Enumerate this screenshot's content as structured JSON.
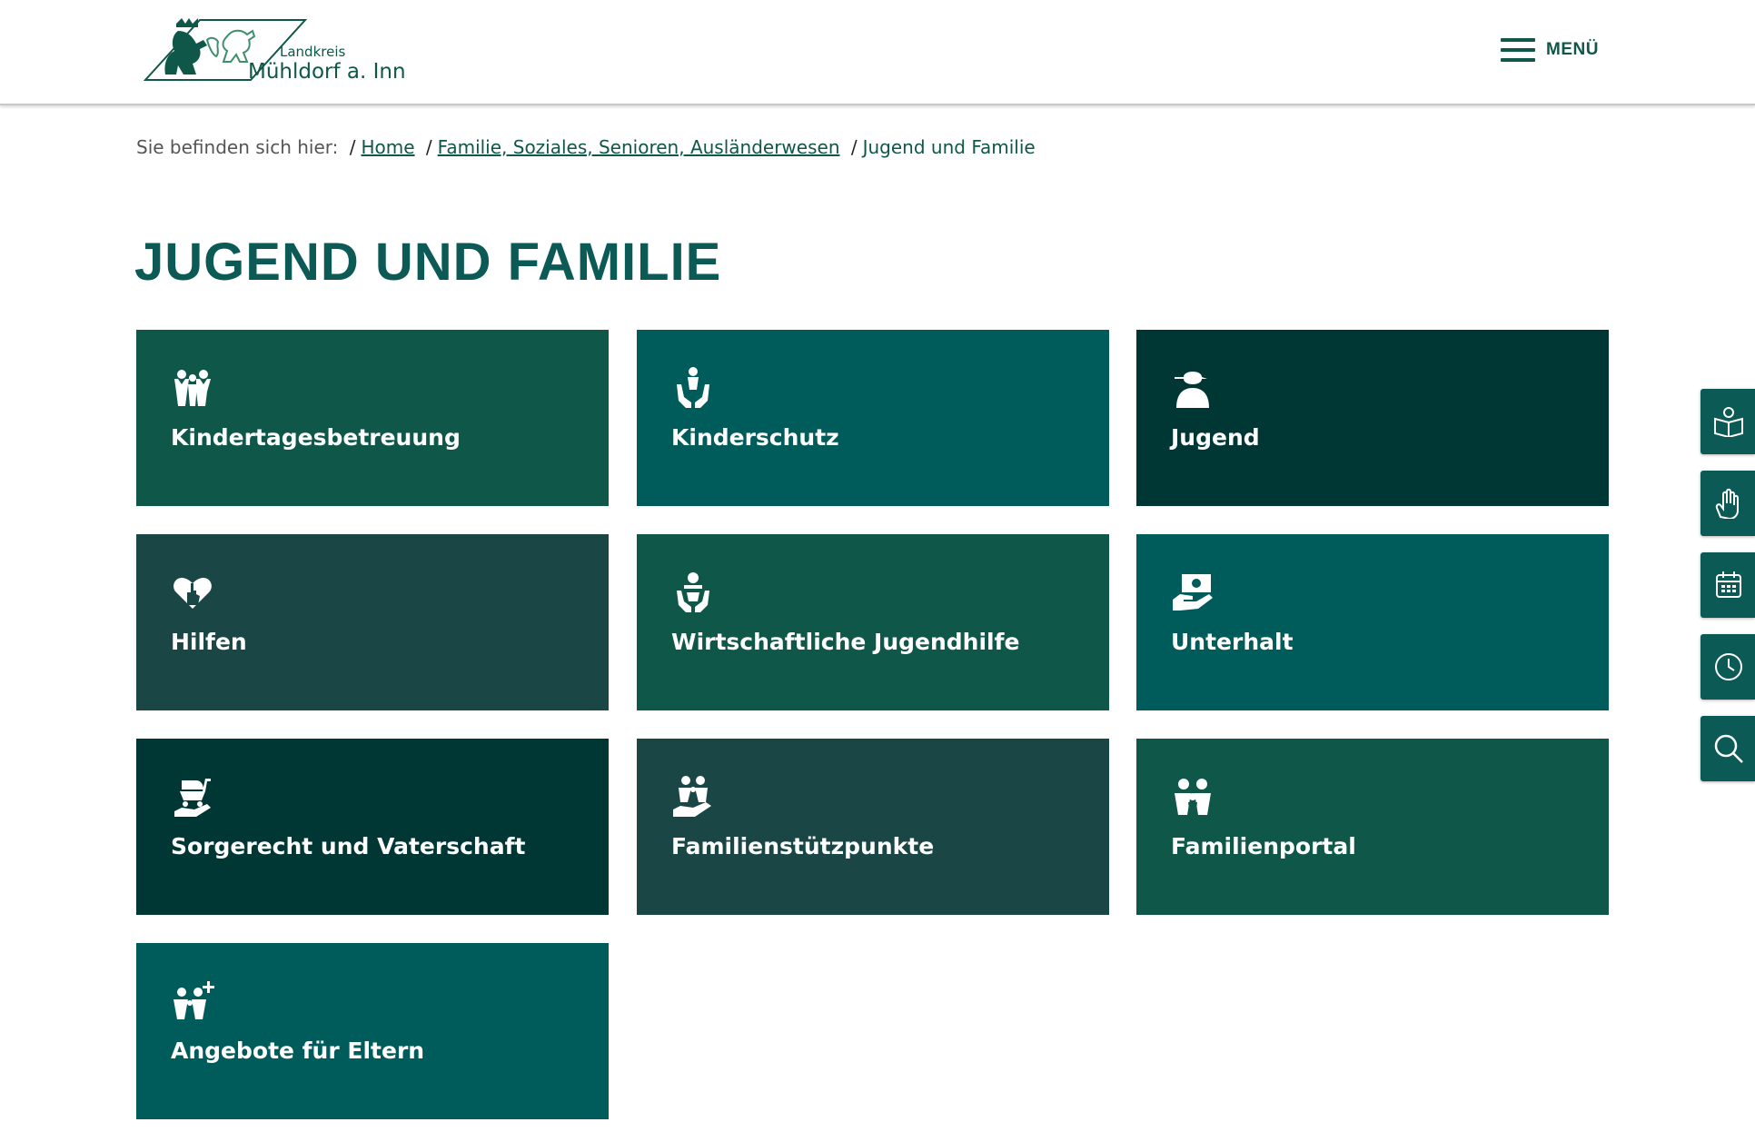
{
  "header": {
    "logo_small": "Landkreis",
    "logo_big": "Mühldorf a. Inn",
    "menu_label": "MENÜ"
  },
  "breadcrumb": {
    "prefix": "Sie befinden sich hier:",
    "separator": "/",
    "items": [
      {
        "label": "Home"
      },
      {
        "label": "Familie, Soziales, Senioren, Ausländerwesen"
      }
    ],
    "current": "Jugend und Familie"
  },
  "page": {
    "title": "JUGEND UND FAMILIE"
  },
  "tiles": [
    {
      "label": "Kindertagesbetreuung",
      "icon": "children-group-icon",
      "color": "#0e5749"
    },
    {
      "label": "Kinderschutz",
      "icon": "child-protection-hands-icon",
      "color": "#005c5a"
    },
    {
      "label": "Jugend",
      "icon": "youth-cap-icon",
      "color": "#003735"
    },
    {
      "label": "Hilfen",
      "icon": "heart-hand-icon",
      "color": "#1b4646"
    },
    {
      "label": "Wirtschaftliche Jugendhilfe",
      "icon": "person-hands-icon",
      "color": "#0e5749"
    },
    {
      "label": "Unterhalt",
      "icon": "money-hand-icon",
      "color": "#005c5a"
    },
    {
      "label": "Sorgerecht und Vaterschaft",
      "icon": "stroller-hand-icon",
      "color": "#003735"
    },
    {
      "label": "Familienstützpunkte",
      "icon": "family-hand-icon",
      "color": "#1b4646"
    },
    {
      "label": "Familienportal",
      "icon": "family-icon",
      "color": "#0e5749"
    },
    {
      "label": "Angebote für Eltern",
      "icon": "family-plus-icon",
      "color": "#005c5a"
    }
  ],
  "sidebar": [
    {
      "icon": "book-person-icon"
    },
    {
      "icon": "sign-language-hand-icon"
    },
    {
      "icon": "calendar-icon"
    },
    {
      "icon": "clock-icon"
    },
    {
      "icon": "search-icon"
    }
  ],
  "colors": {
    "brand": "#0e5749",
    "title": "#0b5a55",
    "sidebar": "#0b5a55"
  }
}
